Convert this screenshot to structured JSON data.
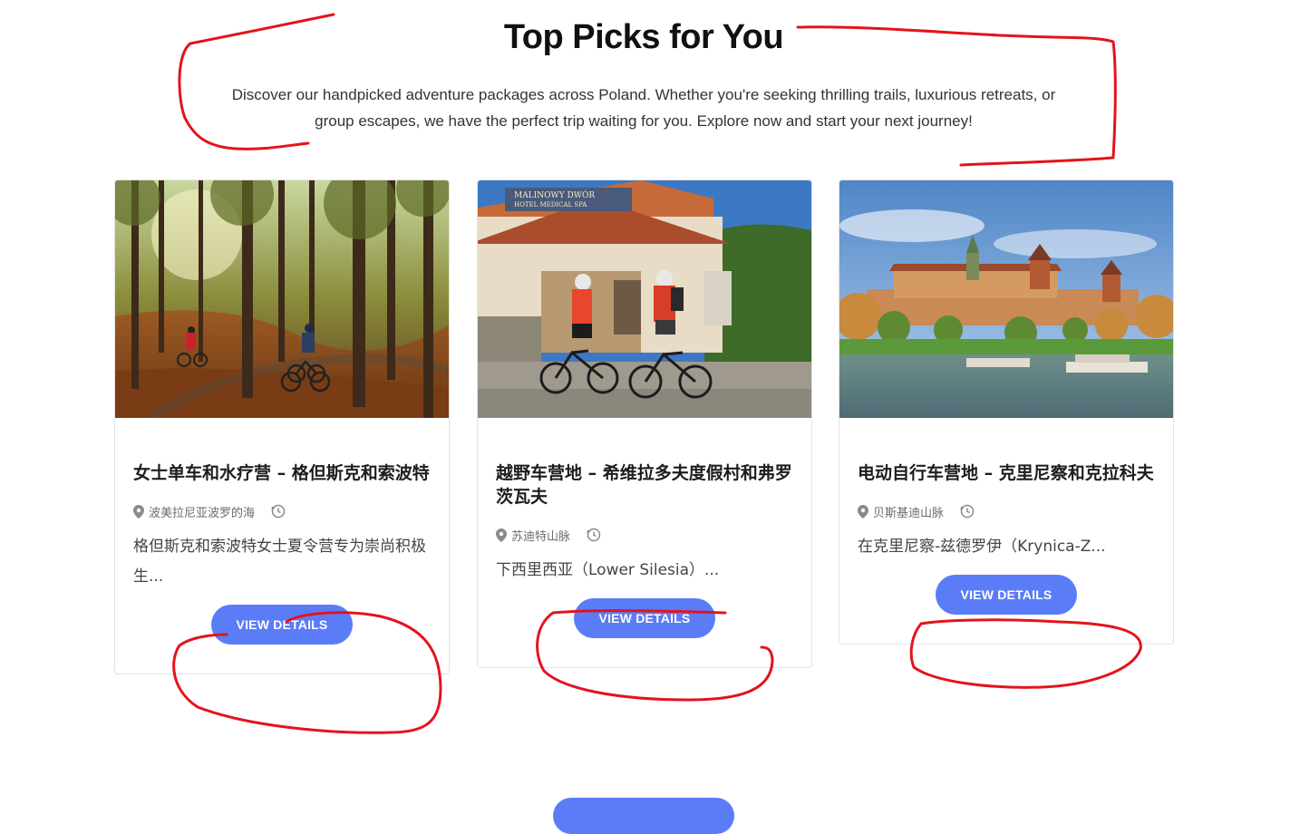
{
  "section": {
    "title": "Top Picks for You",
    "subtitle_line1": "Discover our handpicked adventure packages across Poland. Whether you're seeking thrilling trails, luxurious retreats, or",
    "subtitle_line2": "group escapes, we have the perfect trip waiting for you. Explore now and start your next journey!"
  },
  "cards": [
    {
      "image": "forest-cycling-photo",
      "title": "女士单车和水疗营 – 格但斯克和索波特",
      "location": "波美拉尼亚波罗的海",
      "excerpt": "格但斯克和索波特女士夏令营专为崇尚积极生...",
      "button": "VIEW DETAILS"
    },
    {
      "image": "spa-hotel-cyclists-photo",
      "title": "越野车营地 – 希维拉多夫度假村和弗罗茨瓦夫",
      "location": "苏迪特山脉",
      "excerpt": "下西里西亚（Lower Silesia）...",
      "button": "VIEW DETAILS"
    },
    {
      "image": "wawel-castle-river-photo",
      "title": "电动自行车营地 – 克里尼察和克拉科夫",
      "location": "贝斯基迪山脉",
      "excerpt": "在克里尼察-兹德罗伊（Krynica-Z...",
      "button": "VIEW DETAILS"
    }
  ],
  "colors": {
    "accent": "#5b7cf7",
    "annotation": "#e3141b"
  }
}
